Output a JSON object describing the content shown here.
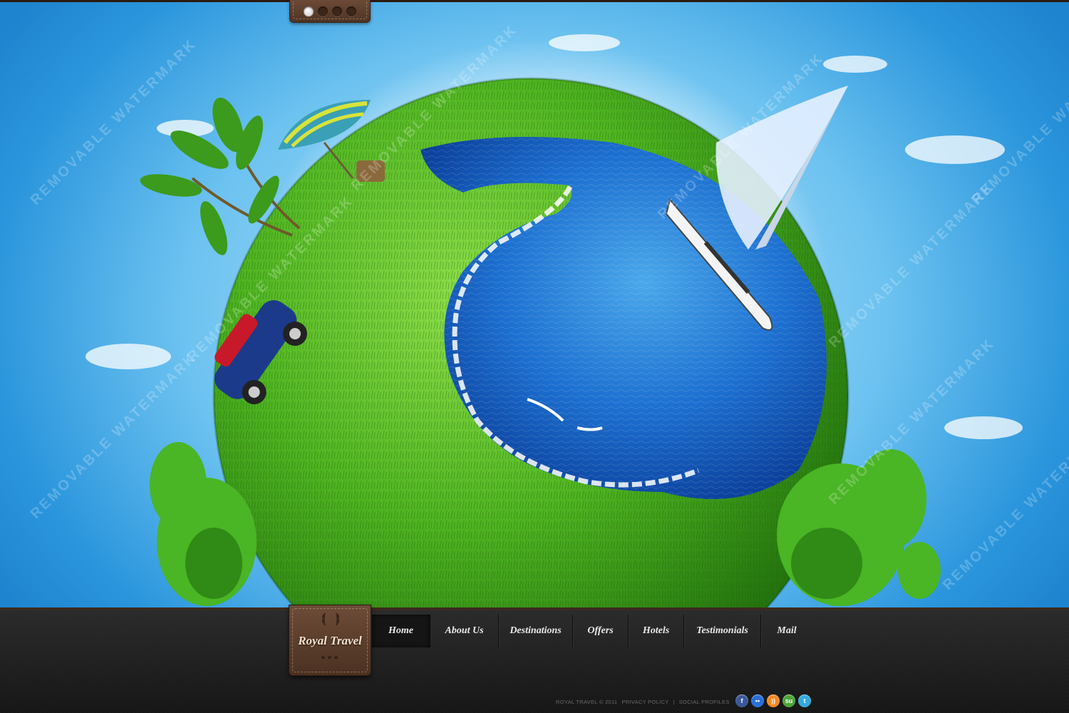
{
  "slider": {
    "dots": 4,
    "active": 0
  },
  "logo": {
    "name": "Royal Travel",
    "stars": "★★★"
  },
  "nav": {
    "items": [
      {
        "label": "Home",
        "active": true
      },
      {
        "label": "About Us"
      },
      {
        "label": "Destinations"
      },
      {
        "label": "Offers"
      },
      {
        "label": "Hotels"
      },
      {
        "label": "Testimonials"
      },
      {
        "label": "Mail"
      }
    ]
  },
  "footer": {
    "copyright": "ROYAL TRAVEL © 2011",
    "privacy": "PRIVACY POLICY",
    "separator": "|",
    "social_label": "SOCIAL PROFILES",
    "socials": [
      {
        "name": "facebook-icon",
        "glyph": "f",
        "color": "#3b5998"
      },
      {
        "name": "flickr-icon",
        "glyph": "••",
        "color": "#2b6fd6"
      },
      {
        "name": "rss-icon",
        "glyph": "))",
        "color": "#f08a24"
      },
      {
        "name": "stumbleupon-icon",
        "glyph": "su",
        "color": "#4da33b"
      },
      {
        "name": "twitter-icon",
        "glyph": "t",
        "color": "#33aadd"
      }
    ]
  },
  "watermark": "REMOVABLE WATERMARK"
}
